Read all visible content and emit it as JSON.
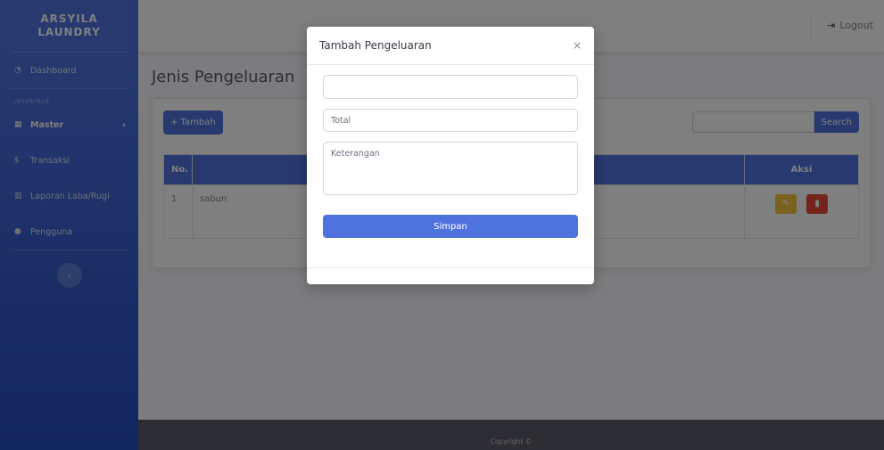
{
  "brand": {
    "line1": "ARSYILA",
    "line2": "LAUNDRY"
  },
  "sidebar": {
    "items": [
      {
        "label": "Dashboard",
        "icon": "tachometer-icon"
      },
      {
        "label": "Master",
        "icon": "table-icon"
      },
      {
        "label": "Transaksi",
        "icon": "dollar-icon"
      },
      {
        "label": "Laporan Laba/Rugi",
        "icon": "chart-icon"
      },
      {
        "label": "Pengguna",
        "icon": "user-icon"
      }
    ],
    "heading": "INTERFACE"
  },
  "topbar": {
    "logout_label": "Logout"
  },
  "page": {
    "title": "Jenis Pengeluaran"
  },
  "toolbar": {
    "add_label": "+ Tambah",
    "search_label": "Search"
  },
  "table": {
    "headers": [
      "No.",
      "",
      "Aksi"
    ],
    "rows": [
      {
        "no": "1",
        "name": "sabun"
      }
    ]
  },
  "modal": {
    "title": "Tambah Pengeluaran",
    "close": "×",
    "name_value": "",
    "total_placeholder": "Total",
    "keterangan_placeholder": "Keterangan",
    "save_label": "Simpan"
  },
  "footer": {
    "text": "Copyright ©"
  },
  "colors": {
    "primary": "#4e73df",
    "warning": "#f6c23e",
    "danger": "#e74a3b"
  }
}
